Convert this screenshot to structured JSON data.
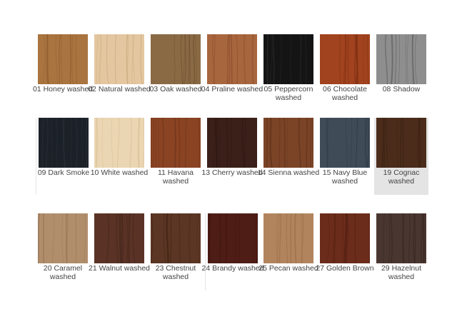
{
  "rows": [
    {
      "items": [
        {
          "name": "01 Honey washed",
          "color": "#a9743f",
          "grain": "#8c5a2c"
        },
        {
          "name": "02 Natural washed",
          "color": "#e4c7a0",
          "grain": "#caa77d"
        },
        {
          "name": "03 Oak washed",
          "color": "#8a6a45",
          "grain": "#6f5232"
        },
        {
          "name": "04 Praline washed",
          "color": "#a8663f",
          "grain": "#8a4c2a"
        },
        {
          "name": "05 Peppercorn washed",
          "color": "#141414",
          "grain": "#262626"
        },
        {
          "name": "06 Chocolate washed",
          "color": "#a1431e",
          "grain": "#7c2e12"
        },
        {
          "name": "08 Shadow",
          "color": "#8e8e8e",
          "grain": "#5f5f5f"
        }
      ]
    },
    {
      "items": [
        {
          "name": "09 Dark Smoke",
          "color": "#1b2127",
          "grain": "#2b333b"
        },
        {
          "name": "10 White washed",
          "color": "#ead6b2",
          "grain": "#d5bd95"
        },
        {
          "name": "11 Havana washed",
          "color": "#8a4424",
          "grain": "#6d3118"
        },
        {
          "name": "13 Cherry washed",
          "color": "#3b2019",
          "grain": "#2a150f"
        },
        {
          "name": "14 Sienna washed",
          "color": "#7b4427",
          "grain": "#5f3119"
        },
        {
          "name": "15 Navy Blue washed",
          "color": "#3f4c58",
          "grain": "#2d3842"
        },
        {
          "name": "19 Cognac washed",
          "color": "#4b2c1a",
          "grain": "#371e10"
        }
      ]
    },
    {
      "items": [
        {
          "name": "20 Caramel washed",
          "color": "#b18e6b",
          "grain": "#957252"
        },
        {
          "name": "21 Walnut washed",
          "color": "#5a3326",
          "grain": "#43241a"
        },
        {
          "name": "23 Chestnut washed",
          "color": "#5b3624",
          "grain": "#442517"
        },
        {
          "name": "24 Brandy washed",
          "color": "#4e1d16",
          "grain": "#3a120c"
        },
        {
          "name": "25 Pecan washed",
          "color": "#b2845d",
          "grain": "#966a45"
        },
        {
          "name": "27 Golden Brown",
          "color": "#6b2c1b",
          "grain": "#501d10"
        },
        {
          "name": "29 Hazelnut washed",
          "color": "#4a3630",
          "grain": "#352520"
        }
      ]
    }
  ]
}
